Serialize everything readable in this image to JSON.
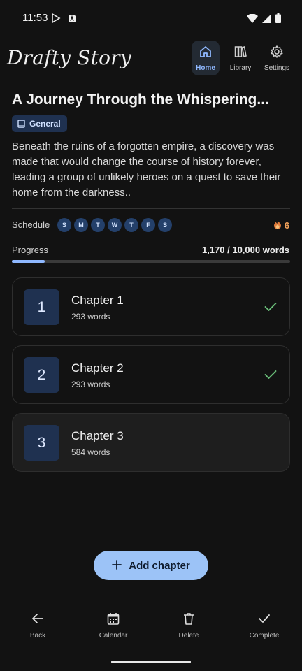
{
  "status": {
    "time": "11:53"
  },
  "app": {
    "title": "Drafty Story"
  },
  "nav": [
    {
      "label": "Home",
      "icon": "home-icon",
      "active": true
    },
    {
      "label": "Library",
      "icon": "library-icon",
      "active": false
    },
    {
      "label": "Settings",
      "icon": "gear-icon",
      "active": false
    }
  ],
  "story": {
    "title": "A Journey Through the Whispering...",
    "tag": "General",
    "description": "Beneath the ruins of a forgotten empire, a discovery was made that would change the course of history forever, leading a group of unlikely heroes on a quest to save their home from the darkness.."
  },
  "schedule": {
    "label": "Schedule",
    "days": [
      "S",
      "M",
      "T",
      "W",
      "T",
      "F",
      "S"
    ],
    "streak": "6"
  },
  "progress": {
    "label": "Progress",
    "count": "1,170 / 10,000 words",
    "fraction": 0.117
  },
  "chapters": [
    {
      "number": "1",
      "name": "Chapter 1",
      "words": "293 words",
      "completed": true
    },
    {
      "number": "2",
      "name": "Chapter 2",
      "words": "293 words",
      "completed": true
    },
    {
      "number": "3",
      "name": "Chapter 3",
      "words": "584 words",
      "completed": false
    }
  ],
  "add_button": {
    "label": "Add chapter"
  },
  "bottom_bar": [
    {
      "label": "Back",
      "icon": "back-arrow-icon"
    },
    {
      "label": "Calendar",
      "icon": "calendar-icon"
    },
    {
      "label": "Delete",
      "icon": "trash-icon"
    },
    {
      "label": "Complete",
      "icon": "checkmark-icon"
    }
  ],
  "colors": {
    "accent": "#8fb8ff",
    "button": "#9cc3f7",
    "tag_bg": "#1f3150",
    "streak": "#f0a15a",
    "check": "#6bbf7a"
  }
}
